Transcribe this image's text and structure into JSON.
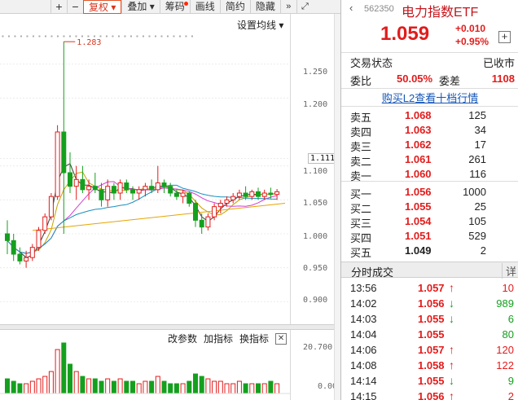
{
  "toolbar": {
    "plus": "+",
    "minus": "−",
    "fuquan": "复权",
    "fuquan_arrow": "▾",
    "diejia": "叠加",
    "diejia_arrow": "▾",
    "chouma": "筹码",
    "huaxian": "画线",
    "jianyue": "简约",
    "yincang": "隐藏",
    "more": "»",
    "expand": "⤢"
  },
  "chart": {
    "ma_settings": "设置均线 ▾",
    "price_labels": [
      "1.250",
      "1.200",
      "1.111",
      "1.100",
      "1.050",
      "1.000",
      "0.950",
      "0.900"
    ],
    "current_price_mark": "1.111",
    "peak_label": "1.283",
    "volume_labels": [
      "20.700",
      "0.000"
    ],
    "tool_params": "改参数",
    "tool_add": "加指标",
    "tool_switch": "换指标",
    "tool_close": "✕",
    "colors": {
      "up": "#e21c1c",
      "down": "#14a01e"
    }
  },
  "chart_data": {
    "type": "candlestick",
    "peak_annotation": "1.283",
    "yticks": [
      0.9,
      0.95,
      1.0,
      1.05,
      1.1,
      1.111,
      1.2,
      1.25
    ],
    "candles": [
      [
        1.0,
        1.02,
        0.97,
        0.99
      ],
      [
        0.99,
        1.0,
        0.96,
        0.97
      ],
      [
        0.97,
        0.98,
        0.955,
        0.96
      ],
      [
        0.96,
        0.975,
        0.95,
        0.965
      ],
      [
        0.965,
        0.985,
        0.96,
        0.98
      ],
      [
        0.98,
        1.01,
        0.975,
        1.005
      ],
      [
        1.005,
        1.03,
        1.0,
        1.025
      ],
      [
        1.025,
        1.06,
        1.02,
        1.055
      ],
      [
        1.055,
        1.16,
        1.05,
        1.15
      ],
      [
        1.15,
        1.283,
        1.0,
        1.09
      ],
      [
        1.09,
        1.12,
        1.06,
        1.07
      ],
      [
        1.07,
        1.1,
        1.05,
        1.08
      ],
      [
        1.08,
        1.1,
        1.06,
        1.065
      ],
      [
        1.065,
        1.08,
        1.05,
        1.07
      ],
      [
        1.07,
        1.09,
        1.06,
        1.065
      ],
      [
        1.065,
        1.075,
        1.04,
        1.05
      ],
      [
        1.05,
        1.08,
        1.04,
        1.07
      ],
      [
        1.07,
        1.075,
        1.05,
        1.06
      ],
      [
        1.06,
        1.08,
        1.05,
        1.075
      ],
      [
        1.075,
        1.08,
        1.06,
        1.065
      ],
      [
        1.065,
        1.07,
        1.05,
        1.06
      ],
      [
        1.06,
        1.07,
        1.05,
        1.065
      ],
      [
        1.065,
        1.075,
        1.055,
        1.07
      ],
      [
        1.07,
        1.08,
        1.06,
        1.065
      ],
      [
        1.065,
        1.1,
        1.06,
        1.075
      ],
      [
        1.075,
        1.08,
        1.06,
        1.07
      ],
      [
        1.07,
        1.075,
        1.055,
        1.06
      ],
      [
        1.06,
        1.065,
        1.05,
        1.055
      ],
      [
        1.055,
        1.065,
        1.045,
        1.06
      ],
      [
        1.06,
        1.062,
        1.04,
        1.045
      ],
      [
        1.045,
        1.05,
        1.01,
        1.02
      ],
      [
        1.02,
        1.03,
        1.0,
        1.01
      ],
      [
        1.01,
        1.03,
        1.005,
        1.025
      ],
      [
        1.025,
        1.045,
        1.02,
        1.04
      ],
      [
        1.04,
        1.05,
        1.03,
        1.045
      ],
      [
        1.045,
        1.055,
        1.04,
        1.05
      ],
      [
        1.05,
        1.06,
        1.045,
        1.055
      ],
      [
        1.055,
        1.065,
        1.05,
        1.06
      ],
      [
        1.06,
        1.07,
        1.05,
        1.055
      ],
      [
        1.055,
        1.065,
        1.05,
        1.062
      ],
      [
        1.062,
        1.068,
        1.05,
        1.055
      ],
      [
        1.055,
        1.065,
        1.05,
        1.06
      ],
      [
        1.06,
        1.068,
        1.052,
        1.058
      ],
      [
        1.058,
        1.066,
        1.05,
        1.062
      ]
    ],
    "volumes": [
      6,
      5,
      4,
      4,
      5,
      6,
      7,
      9,
      18,
      20.7,
      12,
      9,
      7,
      6,
      6,
      5,
      6,
      5,
      6,
      5,
      5,
      4,
      5,
      5,
      7,
      5,
      4,
      4,
      4,
      5,
      8,
      7,
      6,
      5,
      5,
      4,
      4,
      5,
      4,
      4,
      4,
      4,
      5,
      4
    ]
  },
  "quote": {
    "back": "‹",
    "code": "562350",
    "name": "电力指数ETF",
    "price": "1.059",
    "change": "+0.010",
    "change_pct": "+0.95%",
    "add_icon": "+",
    "status_label": "交易状态",
    "status_value": "已收市",
    "weibi_label": "委比",
    "weibi_value": "50.05%",
    "weicha_label": "委差",
    "weicha_value": "1108",
    "l2_link": "购买L2查看十档行情",
    "asks": [
      {
        "label": "卖五",
        "price": "1.068",
        "qty": "125"
      },
      {
        "label": "卖四",
        "price": "1.063",
        "qty": "34"
      },
      {
        "label": "卖三",
        "price": "1.062",
        "qty": "17"
      },
      {
        "label": "卖二",
        "price": "1.061",
        "qty": "261"
      },
      {
        "label": "卖一",
        "price": "1.060",
        "qty": "116"
      }
    ],
    "bids": [
      {
        "label": "买一",
        "price": "1.056",
        "qty": "1000"
      },
      {
        "label": "买二",
        "price": "1.055",
        "qty": "25"
      },
      {
        "label": "买三",
        "price": "1.054",
        "qty": "105"
      },
      {
        "label": "买四",
        "price": "1.051",
        "qty": "529"
      },
      {
        "label": "买五",
        "price": "1.049",
        "qty": "2"
      }
    ],
    "ticks_title": "分时成交",
    "ticks_detail": "详",
    "ticks": [
      {
        "time": "13:56",
        "price": "1.057",
        "dir": "up",
        "vol": "10"
      },
      {
        "time": "14:02",
        "price": "1.056",
        "dir": "dn",
        "vol": "989"
      },
      {
        "time": "14:03",
        "price": "1.055",
        "dir": "dn",
        "vol": "6"
      },
      {
        "time": "14:04",
        "price": "1.055",
        "dir": "flat",
        "vol": "80"
      },
      {
        "time": "14:06",
        "price": "1.057",
        "dir": "up",
        "vol": "120"
      },
      {
        "time": "14:08",
        "price": "1.058",
        "dir": "up",
        "vol": "122"
      },
      {
        "time": "14:14",
        "price": "1.055",
        "dir": "dn",
        "vol": "9"
      },
      {
        "time": "14:15",
        "price": "1.056",
        "dir": "up",
        "vol": "2"
      }
    ]
  }
}
